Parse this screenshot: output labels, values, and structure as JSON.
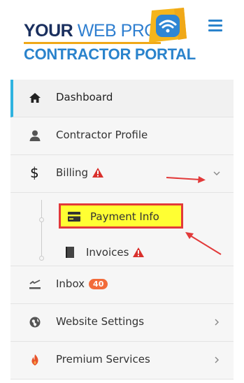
{
  "brand": {
    "line1_a": "YOUR",
    "line1_b": "WEB PRO",
    "line2": "CONTRACTOR PORTAL",
    "colors": {
      "navy": "#1a2f5e",
      "blue": "#2a83cc",
      "gold": "#f0a818"
    }
  },
  "nav": {
    "dashboard": {
      "label": "Dashboard",
      "icon": "home-icon"
    },
    "profile": {
      "label": "Contractor Profile",
      "icon": "user-icon"
    },
    "billing": {
      "label": "Billing",
      "icon": "dollar-icon",
      "children": [
        {
          "label": "Payment Info",
          "icon": "credit-card-icon"
        },
        {
          "label": "Invoices",
          "icon": "document-icon"
        }
      ]
    },
    "inbox": {
      "label": "Inbox",
      "count": "40",
      "icon": "inbox-icon"
    },
    "website": {
      "label": "Website Settings",
      "icon": "globe-icon"
    },
    "premium": {
      "label": "Premium Services",
      "icon": "flame-icon"
    }
  },
  "dollar_symbol": "$",
  "colors": {
    "accent": "#2fb3e0",
    "warning": "#d9302c",
    "badge": "#f26b3a",
    "highlight": "#ffff33",
    "annotation": "#e23a3a"
  }
}
